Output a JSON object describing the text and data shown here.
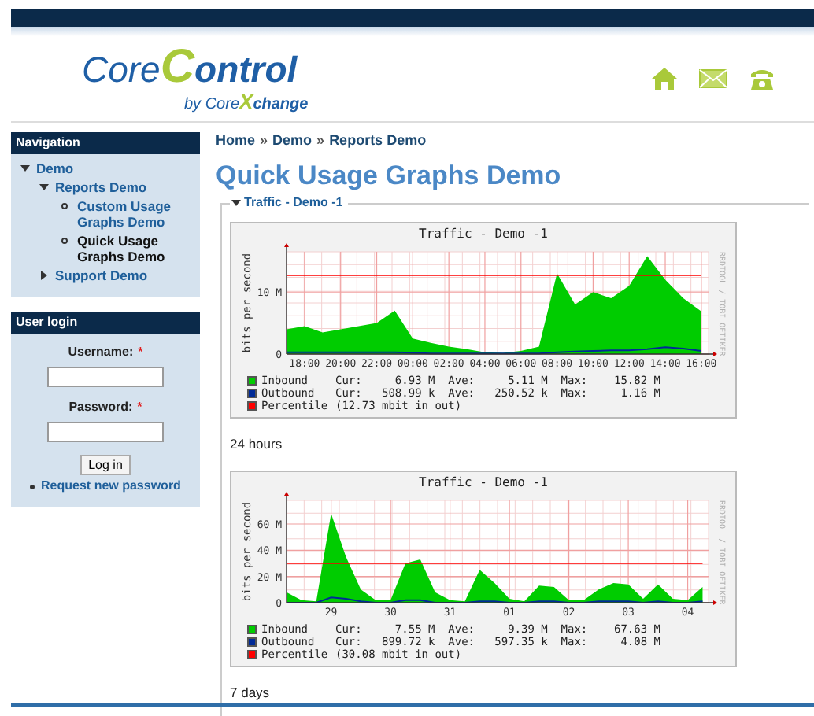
{
  "logo": {
    "title_parts": [
      "Core",
      "C",
      "ontrol"
    ],
    "tagline_parts": [
      "by Core",
      "X",
      "change"
    ]
  },
  "navigation": {
    "title": "Navigation",
    "items": [
      {
        "label": "Demo",
        "expanded": true,
        "selected": false,
        "children": [
          {
            "label": "Reports Demo",
            "expanded": true,
            "selected": false,
            "children": [
              {
                "label": "Custom Usage Graphs Demo",
                "selected": false
              },
              {
                "label": "Quick Usage Graphs Demo",
                "selected": true
              }
            ]
          },
          {
            "label": "Support Demo",
            "expanded": false,
            "selected": false
          }
        ]
      }
    ]
  },
  "user_login": {
    "title": "User login",
    "username_label": "Username:",
    "password_label": "Password:",
    "required_mark": "*",
    "button": "Log in",
    "link": "Request new password"
  },
  "breadcrumb": [
    {
      "kind": "link",
      "label": "Home"
    },
    {
      "kind": "separator",
      "label": "»"
    },
    {
      "kind": "link",
      "label": "Demo"
    },
    {
      "kind": "separator",
      "label": "»"
    },
    {
      "kind": "link",
      "label": "Reports Demo"
    }
  ],
  "page_title": "Quick Usage Graphs Demo",
  "section": {
    "title": "Traffic - Demo -1",
    "expanded": true
  },
  "graphs": [
    {
      "caption": "24 hours",
      "side_label": "RRDTOOL / TOBI OETIKER",
      "legend_stats": [
        "Cur:     6.93 M  Ave:     5.11 M  Max:    15.82 M",
        "Cur:   508.99 k  Ave:   250.52 k  Max:     1.16 M",
        "(12.73 mbit in out)"
      ],
      "chart_data": {
        "type": "area",
        "title": "Traffic - Demo -1",
        "ylabel": "bits per second",
        "grid": true,
        "legend": true,
        "ylim": [
          0,
          16.5
        ],
        "categories": [
          null,
          "18:00",
          null,
          "20:00",
          null,
          "22:00",
          null,
          "00:00",
          null,
          "02:00",
          null,
          "04:00",
          null,
          "06:00",
          null,
          "08:00",
          null,
          "10:00",
          null,
          "12:00",
          null,
          "14:00",
          null,
          "16:00"
        ],
        "yticks": [
          {
            "value": 0,
            "label": "0"
          },
          {
            "value": 10,
            "label": "10 M"
          }
        ],
        "series": [
          {
            "name": "Inbound",
            "type": "area",
            "color": "#00cc00",
            "values": [
              4,
              4.5,
              3.5,
              4,
              4.5,
              5,
              7,
              2.5,
              1.8,
              1.2,
              0.8,
              0.3,
              0.2,
              0.5,
              1.2,
              13,
              8,
              10,
              9,
              11,
              15.8,
              12,
              9,
              6.9
            ]
          },
          {
            "name": "Outbound",
            "type": "line",
            "color": "#002a97",
            "values": [
              0.3,
              0.3,
              0.3,
              0.3,
              0.3,
              0.3,
              0.3,
              0.2,
              0.1,
              0.1,
              0.1,
              0.1,
              0.1,
              0.1,
              0.1,
              0.3,
              0.4,
              0.5,
              0.6,
              0.6,
              0.8,
              1.1,
              0.9,
              0.5
            ]
          },
          {
            "name": "Percentile",
            "type": "line",
            "color": "#ff0000",
            "values": [
              12.7,
              12.7,
              12.7,
              12.7,
              12.7,
              12.7,
              12.7,
              12.7,
              12.7,
              12.7,
              12.7,
              12.7,
              12.7,
              12.7,
              12.7,
              12.7,
              12.7,
              12.7,
              12.7,
              12.7,
              12.7,
              12.7,
              12.7,
              12.7
            ]
          }
        ]
      }
    },
    {
      "caption": "7 days",
      "side_label": "RRDTOOL / TOBI OETIKER",
      "legend_stats": [
        "Cur:     7.55 M  Ave:     9.39 M  Max:    67.63 M",
        "Cur:   899.72 k  Ave:   597.35 k  Max:     4.08 M",
        "(30.08 mbit in out)"
      ],
      "chart_data": {
        "type": "area",
        "title": "Traffic - Demo -1",
        "ylabel": "bits per second",
        "grid": true,
        "legend": true,
        "ylim": [
          0,
          78
        ],
        "categories": [
          null,
          null,
          null,
          "29",
          null,
          null,
          null,
          "30",
          null,
          null,
          null,
          "31",
          null,
          null,
          null,
          "01",
          null,
          null,
          null,
          "02",
          null,
          null,
          null,
          "03",
          null,
          null,
          null,
          "04",
          null
        ],
        "yticks": [
          {
            "value": 0,
            "label": "0"
          },
          {
            "value": 20,
            "label": "20 M"
          },
          {
            "value": 40,
            "label": "40 M"
          },
          {
            "value": 60,
            "label": "60 M"
          }
        ],
        "series": [
          {
            "name": "Inbound",
            "type": "area",
            "color": "#00cc00",
            "values": [
              8,
              2,
              1,
              68,
              35,
              10,
              2,
              2,
              30,
              33,
              8,
              2,
              1,
              25,
              15,
              3,
              1,
              13,
              12,
              2,
              2,
              10,
              15,
              14,
              3,
              14,
              3,
              2,
              12
            ]
          },
          {
            "name": "Outbound",
            "type": "line",
            "color": "#002a97",
            "values": [
              0,
              0,
              0,
              4,
              3,
              1,
              0,
              0,
              2,
              2,
              0,
              0,
              0,
              1,
              1,
              0,
              0,
              1,
              1,
              0,
              0,
              1,
              1,
              1,
              0,
              1,
              0,
              0,
              1
            ]
          },
          {
            "name": "Percentile",
            "type": "line",
            "color": "#ff0000",
            "values": [
              30,
              30,
              30,
              30,
              30,
              30,
              30,
              30,
              30,
              30,
              30,
              30,
              30,
              30,
              30,
              30,
              30,
              30,
              30,
              30,
              30,
              30,
              30,
              30,
              30,
              30,
              30,
              30,
              30
            ]
          }
        ]
      }
    }
  ]
}
